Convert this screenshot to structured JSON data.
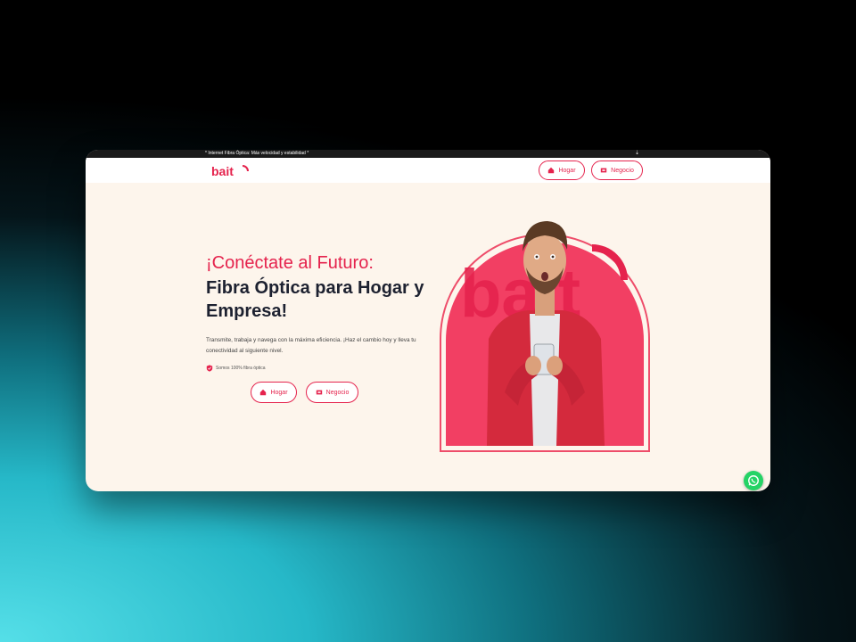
{
  "announcement": {
    "text": "* Internet Fibra Óptica: Más velocidad y estabilidad *",
    "pin_icon": "map-pin-icon"
  },
  "header": {
    "logo_text": "bait",
    "nav": [
      {
        "label": "Hogar",
        "icon": "home-icon"
      },
      {
        "label": "Negocio",
        "icon": "business-icon"
      }
    ]
  },
  "hero": {
    "title_line1": "¡Conéctate al Futuro:",
    "title_line2": "Fibra Óptica para Hogar y Empresa!",
    "description": "Transmite, trabaja y navega con la máxima eficiencia. ¡Haz el cambio hoy y lleva tu conectividad al siguiente nivel.",
    "badge": "Somos 100% fibra óptica",
    "buttons": [
      {
        "label": "Hogar",
        "icon": "home-icon"
      },
      {
        "label": "Negocio",
        "icon": "business-icon"
      }
    ],
    "image": "man-with-phone-photo"
  },
  "floating": {
    "icon": "whatsapp-icon"
  },
  "colors": {
    "brand": "#e5234d",
    "dark_text": "#1d2130",
    "hero_bg": "#fdf5ec",
    "whatsapp": "#25d366"
  }
}
